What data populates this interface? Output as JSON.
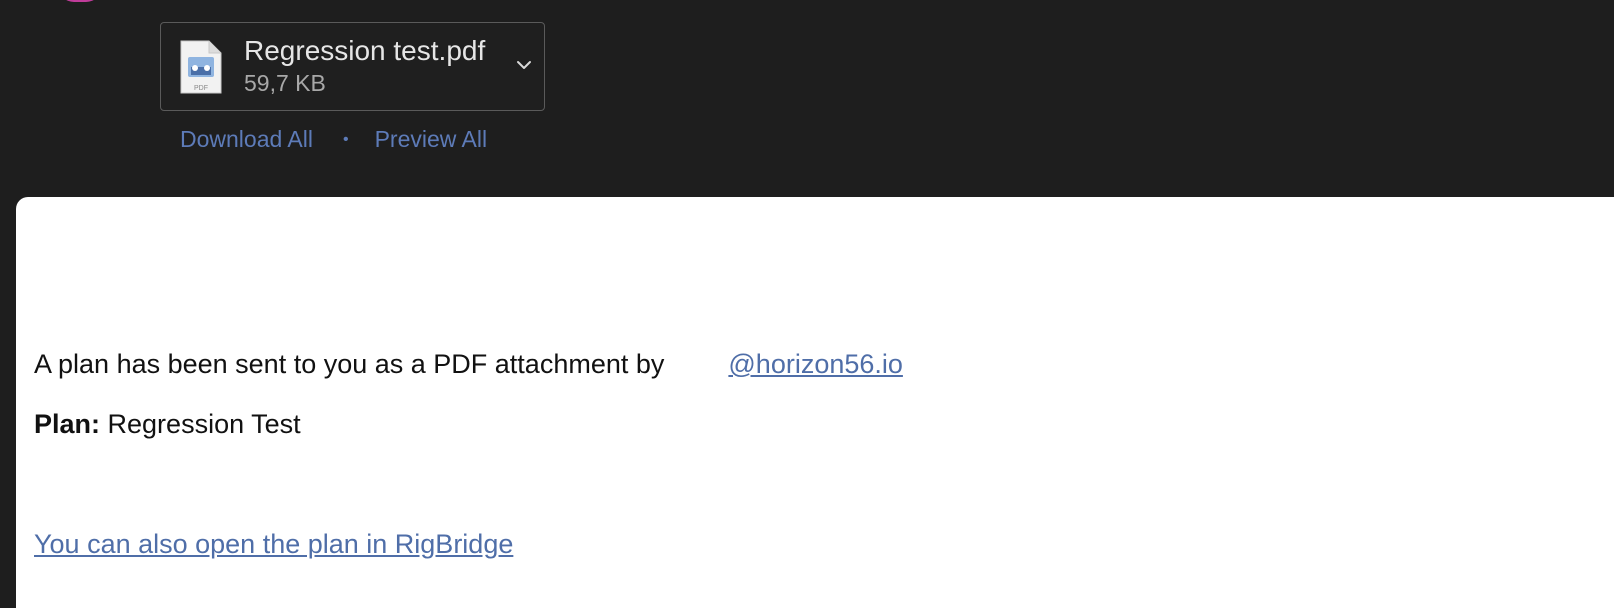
{
  "attachment": {
    "file_name": "Regression test.pdf",
    "file_size": "59,7 KB",
    "icon": "pdf-file-icon",
    "icon_badge": "PDF"
  },
  "attachment_actions": {
    "download_all": "Download All",
    "separator": "•",
    "preview_all": "Preview All"
  },
  "message": {
    "intro_text": "A plan has been sent to you as a PDF attachment by",
    "sender": "@horizon56.io",
    "plan_label": "Plan:",
    "plan_name": "Regression Test",
    "open_link": "You can also open the plan in RigBridge"
  },
  "colors": {
    "background": "#1e1e1e",
    "link": "#4f6ea8",
    "avatar": "#c03c9a"
  }
}
